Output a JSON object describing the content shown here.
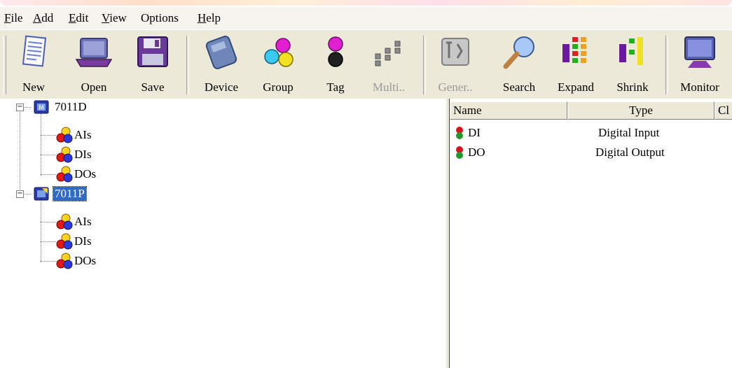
{
  "menu": [
    "File",
    "Add",
    "Edit",
    "View",
    "Options",
    "Help"
  ],
  "menu_mnemonics": [
    "F",
    "A",
    "E",
    "V",
    "",
    "H"
  ],
  "toolbar": {
    "new": "New",
    "open": "Open",
    "save": "Save",
    "device": "Device",
    "group": "Group",
    "tag": "Tag",
    "multi": "Multi..",
    "general": "Gener..",
    "search": "Search",
    "expand": "Expand",
    "shrink": "Shrink",
    "monitor": "Monitor"
  },
  "tree": {
    "devices": [
      {
        "name": "7011D",
        "groups": [
          "AIs",
          "DIs",
          "DOs"
        ]
      },
      {
        "name": "7011P",
        "groups": [
          "AIs",
          "DIs",
          "DOs"
        ]
      }
    ]
  },
  "list": {
    "columns": [
      "Name",
      "Type",
      "Cl"
    ],
    "rows": [
      {
        "name": "DI",
        "type": "Digital Input"
      },
      {
        "name": "DO",
        "type": "Digital Output"
      }
    ]
  },
  "colors": {
    "selection": "#316ac5",
    "toolbar_bg": "#ece9d8",
    "tag_red": "#d8141c",
    "tag_green": "#1e9a2a",
    "group_yellow": "#ffd21e",
    "group_red": "#e01818",
    "group_blue": "#2a3ad8"
  }
}
